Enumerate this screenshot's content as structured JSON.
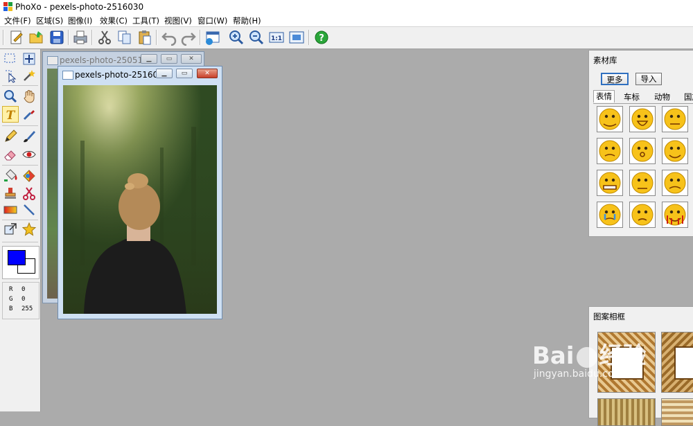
{
  "app": {
    "title": "PhoXo - pexels-photo-2516030"
  },
  "menu": {
    "items": [
      "文件(F)",
      "区域(S)",
      "图像(I)",
      "效果(C)",
      "工具(T)",
      "视图(V)",
      "窗口(W)",
      "帮助(H)"
    ]
  },
  "toolbar": {
    "buttons": [
      "new-icon",
      "open-icon",
      "save-icon",
      "print-icon",
      "cut-icon",
      "copy-icon",
      "paste-icon",
      "undo-icon",
      "redo-icon",
      "image-info-icon",
      "zoom-in-icon",
      "zoom-out-icon",
      "actual-size-icon",
      "fit-window-icon",
      "help-icon"
    ]
  },
  "color_info": {
    "r_label": "R",
    "r": "0",
    "g_label": "G",
    "g": "0",
    "b_label": "B",
    "b": "255",
    "foreground": "#0000ff",
    "background": "#ffffff"
  },
  "windows": {
    "back": {
      "title": "pexels-photo-25051..."
    },
    "front": {
      "title": "pexels-photo-25160..."
    }
  },
  "materials": {
    "title": "素材库",
    "more_button": "更多",
    "import_button": "导入",
    "tabs": [
      "表情",
      "车标",
      "动物",
      "国旗"
    ],
    "active_tab": "表情"
  },
  "frames": {
    "title": "图案相框"
  },
  "watermark": {
    "brand": "Bai",
    "brand_tail": "经验",
    "url": "jingyan.baidu.com"
  }
}
